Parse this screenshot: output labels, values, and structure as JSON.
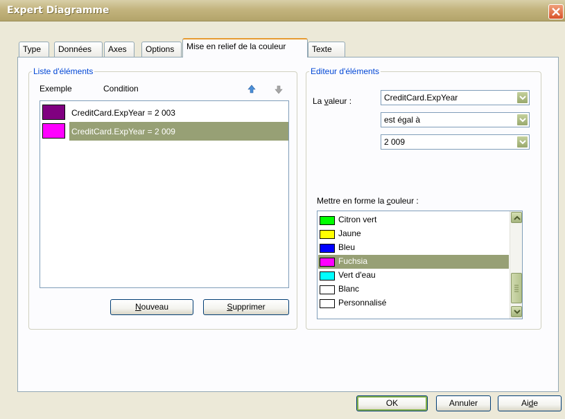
{
  "window": {
    "title": "Expert Diagramme"
  },
  "tabs": [
    {
      "label": "Type"
    },
    {
      "label": "Données"
    },
    {
      "label": "Axes"
    },
    {
      "label": "Options"
    },
    {
      "label": "Mise en relief de la couleur"
    },
    {
      "label": "Texte"
    }
  ],
  "items_group": {
    "legend": "Liste d'éléments",
    "col_example": "Exemple",
    "col_condition": "Condition",
    "items": [
      {
        "color": "#800080",
        "text": "CreditCard.ExpYear = 2 003"
      },
      {
        "color": "#ff00ff",
        "text": "CreditCard.ExpYear = 2 009",
        "selected": true
      }
    ],
    "new_button": {
      "u": "N",
      "rest": "ouveau"
    },
    "delete_button": {
      "u": "S",
      "rest": "upprimer"
    }
  },
  "editor_group": {
    "legend": "Editeur d'éléments",
    "value_label": {
      "pre": "La ",
      "u": "v",
      "rest": "aleur :"
    },
    "field_value": "CreditCard.ExpYear",
    "operator_value": "est égal à",
    "comparison_value": "2 009",
    "color_label": {
      "pre": "Mettre en forme la ",
      "u": "c",
      "rest": "ouleur :"
    },
    "colors": [
      {
        "name": "Citron vert",
        "hex": "#00ff00"
      },
      {
        "name": "Jaune",
        "hex": "#ffff00"
      },
      {
        "name": "Bleu",
        "hex": "#0000ff"
      },
      {
        "name": "Fuchsia",
        "hex": "#ff00ff",
        "selected": true
      },
      {
        "name": "Vert d'eau",
        "hex": "#00ffff"
      },
      {
        "name": "Blanc",
        "hex": "#ffffff"
      },
      {
        "name": "Personnalisé",
        "hex": "#ffffff"
      }
    ]
  },
  "footer": {
    "ok": "OK",
    "cancel": "Annuler",
    "help": {
      "pre": "Ai",
      "u": "d",
      "rest": "e"
    }
  },
  "colors": {
    "selection": "#97a075",
    "group_legend": "#0046d5",
    "active_tab_accent": "#e69a2f"
  }
}
